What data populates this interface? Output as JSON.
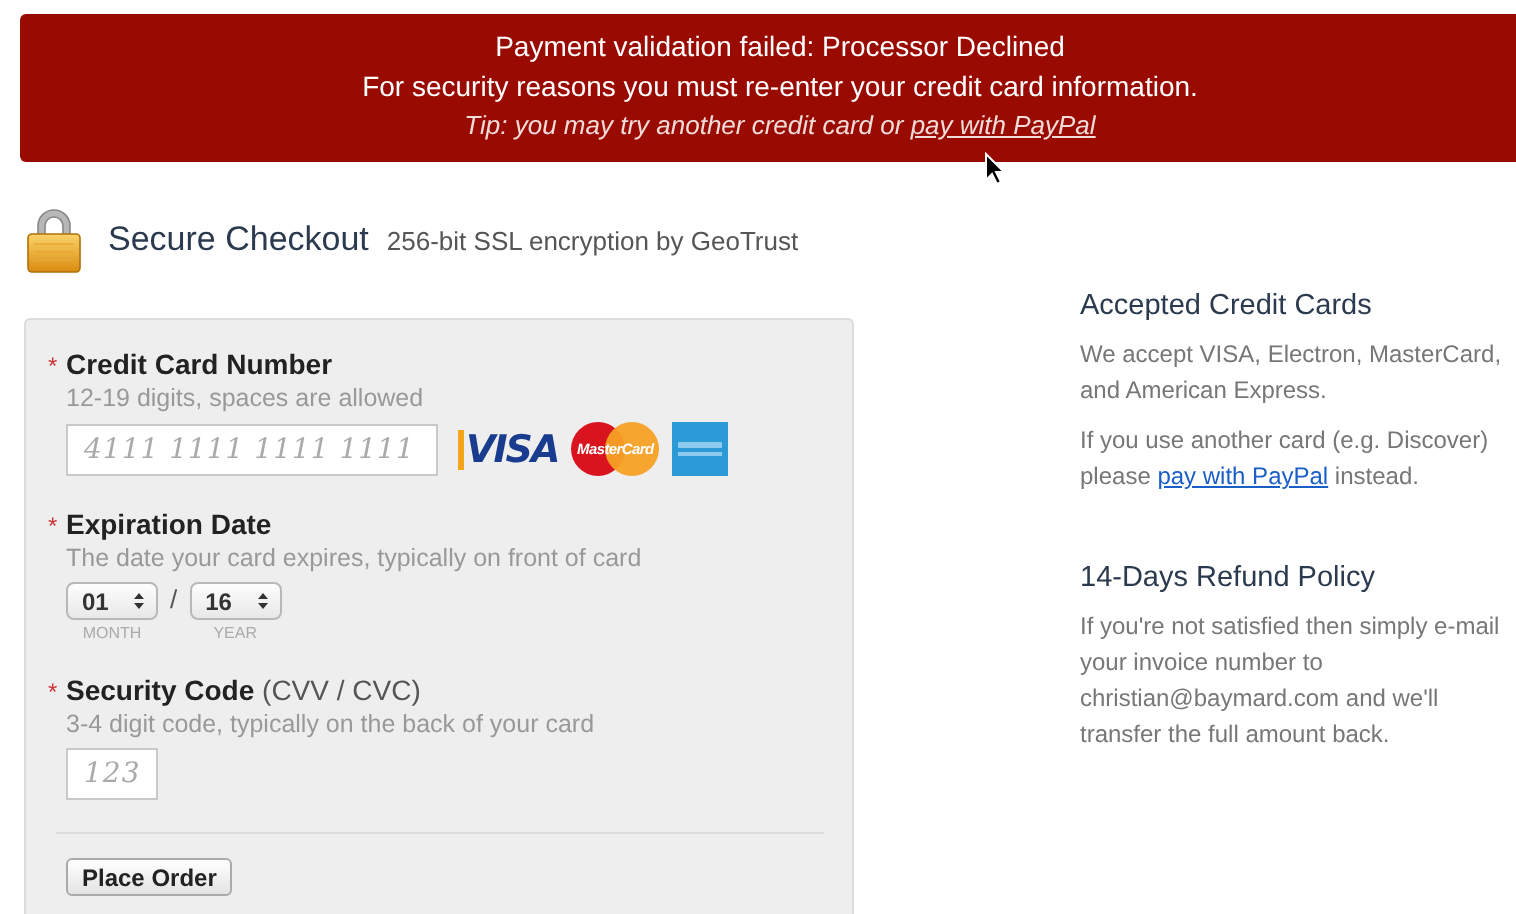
{
  "error_banner": {
    "title": "Payment validation failed: Processor Declined",
    "message": "For security reasons you must re-enter your credit card information.",
    "tip": "Tip: you may try another credit card or ",
    "tip_link": "pay with PayPal"
  },
  "header": {
    "title": "Secure Checkout",
    "subtitle": "256-bit SSL encryption by GeoTrust"
  },
  "form": {
    "required_mark": "*",
    "fields": [
      {
        "kind": "card",
        "label": "Credit Card Number",
        "required": true,
        "hint": "12-19 digits, spaces are allowed",
        "placeholder": "4111 1111 1111 1111",
        "card_logos": [
          {
            "kind": "visa",
            "label": "VISA"
          },
          {
            "kind": "mastercard",
            "label": "MasterCard"
          },
          {
            "kind": "amex"
          }
        ]
      },
      {
        "kind": "expiry",
        "label": "Expiration Date",
        "required": true,
        "hint": "The date your card expires, typically on front of card",
        "selects": [
          {
            "value": "01",
            "caption": "MONTH"
          },
          {
            "value": "16",
            "caption": "YEAR"
          }
        ],
        "separator": "/"
      },
      {
        "kind": "cvv",
        "label": "Security Code",
        "label_note": "(CVV / CVC)",
        "required": true,
        "hint": "3-4 digit code, typically on the back of your card",
        "placeholder": "123"
      }
    ],
    "submit": "Place Order"
  },
  "aside": [
    {
      "heading": "Accepted Credit Cards",
      "paragraphs": [
        {
          "text": "We accept VISA, Electron, MasterCard, and American Express."
        },
        {
          "text": "If you use another card (e.g. Discover) please ",
          "link": "pay with PayPal",
          "after": " instead."
        }
      ]
    },
    {
      "heading": "14-Days Refund Policy",
      "paragraphs": [
        {
          "text": "If you're not satisfied then simply e-mail your invoice number to christian@baymard.com and we'll transfer the full amount back."
        }
      ]
    }
  ]
}
